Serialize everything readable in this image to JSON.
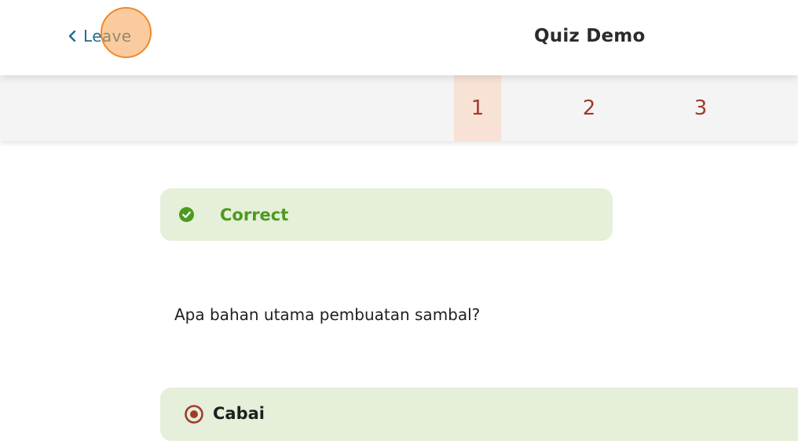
{
  "header": {
    "leave_label": "Leave",
    "title": "Quiz Demo"
  },
  "question_nav": {
    "items": [
      {
        "label": "1",
        "active": true
      },
      {
        "label": "2",
        "active": false
      },
      {
        "label": "3",
        "active": false
      }
    ]
  },
  "feedback": {
    "status": "Correct",
    "icon": "check-circle-icon",
    "color": "#4d9a1e",
    "background": "#e5efd9"
  },
  "question": {
    "text": "Apa bahan utama pembuatan sambal?"
  },
  "answers": [
    {
      "label": "Cabai",
      "selected": true
    }
  ],
  "colors": {
    "accent": "#a23a2c",
    "link": "#1f6b8f",
    "active_tab_bg": "#f8e2d6"
  }
}
